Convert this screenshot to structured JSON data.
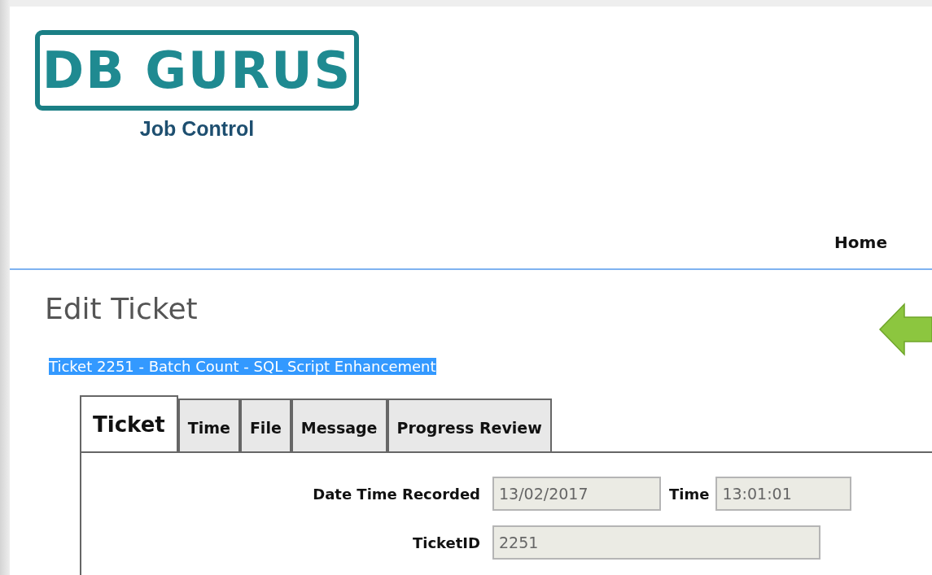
{
  "header": {
    "logo": "DB GURUS",
    "subtitle": "Job Control",
    "nav": [
      {
        "label": "Home"
      }
    ]
  },
  "page": {
    "title": "Edit Ticket",
    "subtitle": {
      "text": "Ticket 2251 - Batch Count - SQL Script Enhancement",
      "highlighted": true
    }
  },
  "tabs": [
    {
      "label": "Ticket",
      "selected": true
    },
    {
      "label": "Time",
      "selected": false
    },
    {
      "label": "File",
      "selected": false
    },
    {
      "label": "Message",
      "selected": false
    },
    {
      "label": "Progress Review",
      "selected": false
    }
  ],
  "form": [
    {
      "label": "Date Time Recorded",
      "value": "13/02/2017",
      "disabled": true,
      "extra": {
        "label": "Time",
        "value": "13:01:01",
        "disabled": true
      }
    },
    {
      "label": "TicketID",
      "value": "2251",
      "disabled": true
    }
  ]
}
